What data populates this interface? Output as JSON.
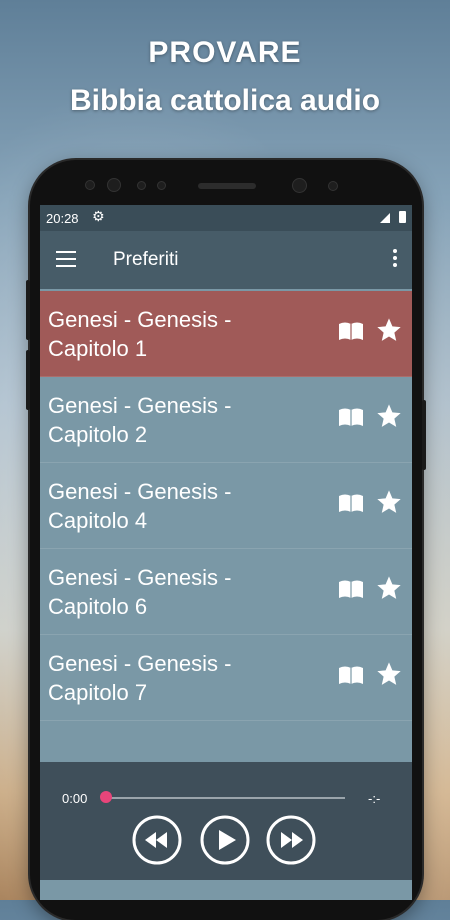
{
  "promo": {
    "line1": "PROVARE",
    "line2": "Bibbia cattolica audio"
  },
  "status_bar": {
    "time": "20:28",
    "settings_icon": "gear-icon"
  },
  "app_bar": {
    "title": "Preferiti",
    "menu_icon": "hamburger-menu-icon",
    "overflow_icon": "more-vert-icon"
  },
  "favorites": [
    {
      "line1": "Genesi - Genesis -",
      "line2": "Capitolo 1",
      "selected": true
    },
    {
      "line1": "Genesi - Genesis -",
      "line2": "Capitolo 2",
      "selected": false
    },
    {
      "line1": "Genesi - Genesis -",
      "line2": "Capitolo 4",
      "selected": false
    },
    {
      "line1": "Genesi - Genesis -",
      "line2": "Capitolo 6",
      "selected": false
    },
    {
      "line1": "Genesi - Genesis -",
      "line2": "Capitolo 7",
      "selected": false
    }
  ],
  "player": {
    "current_time": "0:00",
    "total_time": "-:-",
    "progress": 0,
    "rewind_icon": "rewind-icon",
    "play_icon": "play-icon",
    "fast_forward_icon": "fast-forward-icon"
  },
  "colors": {
    "selected_row": "#a05a58",
    "list_bg": "#7a98a6",
    "app_bar": "#475c68",
    "player_bg": "#3f4f5a",
    "seek_thumb": "#e8457a"
  }
}
